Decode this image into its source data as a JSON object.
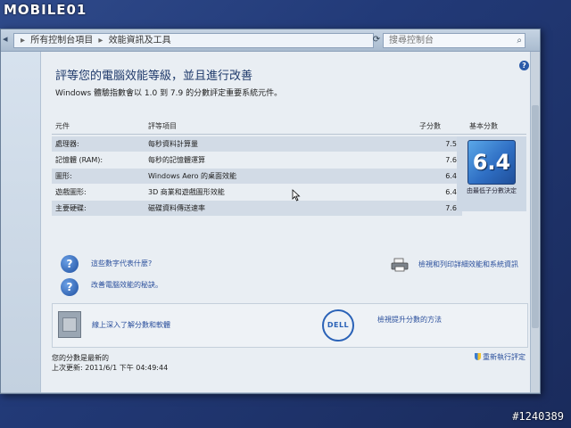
{
  "photo": {
    "watermark": "MOBILE01",
    "post_id": "#1240389"
  },
  "addressbar": {
    "back_glyph": "◂",
    "crumbs": [
      "所有控制台項目",
      "效能資訊及工具"
    ],
    "search_placeholder": "搜尋控制台"
  },
  "header": {
    "title": "評等您的電腦效能等級，並且進行改善",
    "subtitle": "Windows 體驗指數會以 1.0 到 7.9 的分數評定重要系統元件。"
  },
  "table": {
    "headers": {
      "component": "元件",
      "rating": "評等項目",
      "subscore": "子分數",
      "basescore": "基本分數"
    },
    "rows": [
      {
        "component": "處理器:",
        "rating": "每秒資料計算量",
        "subscore": "7.5"
      },
      {
        "component": "記憶體 (RAM):",
        "rating": "每秒的記憶體運算",
        "subscore": "7.6"
      },
      {
        "component": "圖形:",
        "rating": "Windows Aero 的桌面效能",
        "subscore": "6.4"
      },
      {
        "component": "遊戲圖形:",
        "rating": "3D 商業和遊戲圖形效能",
        "subscore": "6.4"
      },
      {
        "component": "主要硬碟:",
        "rating": "磁碟資料傳送速率",
        "subscore": "7.6"
      }
    ],
    "base_score": "6.4",
    "base_note": "由最低子分數決定"
  },
  "links": {
    "what_mean": "這些數字代表什麼?",
    "improve": "改善電腦效能的秘訣。",
    "print_details": "檢視和列印詳細效能和系統資訊",
    "learn_online": "線上深入了解分數和軟體",
    "view_improve": "檢視提升分數的方法",
    "rerun": "重新執行評定"
  },
  "brand": {
    "logo_text": "DELL"
  },
  "status": {
    "line1": "您的分數是最新的",
    "line2": "上次更新: 2011/6/1 下午 04:49:44"
  }
}
